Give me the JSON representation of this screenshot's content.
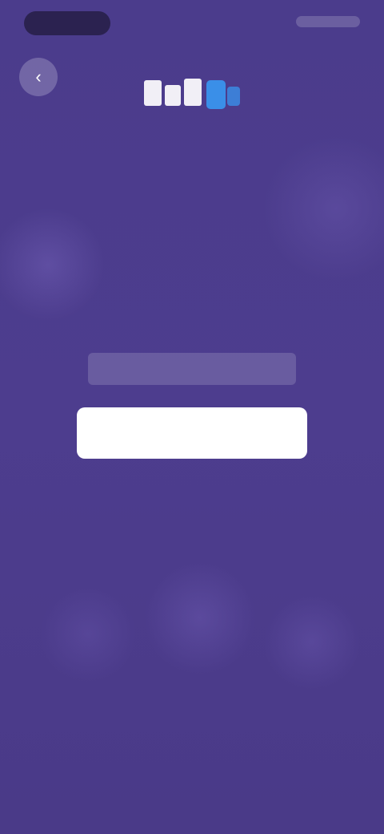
{
  "status_bar": {
    "time": "",
    "indicators": ""
  },
  "header": {
    "back_icon": "chevron-left-icon",
    "logo_colors": {
      "white_part": "#ffffff",
      "blue_part": "#3a8fe8"
    }
  },
  "form": {
    "title": "",
    "email_placeholder": "",
    "continue_label": "",
    "divider_label": "",
    "helper_text": "",
    "link_label": ""
  },
  "colors": {
    "background": "#4a3a8a",
    "button_background": "#ffffff",
    "link": "#5bb1ff"
  }
}
